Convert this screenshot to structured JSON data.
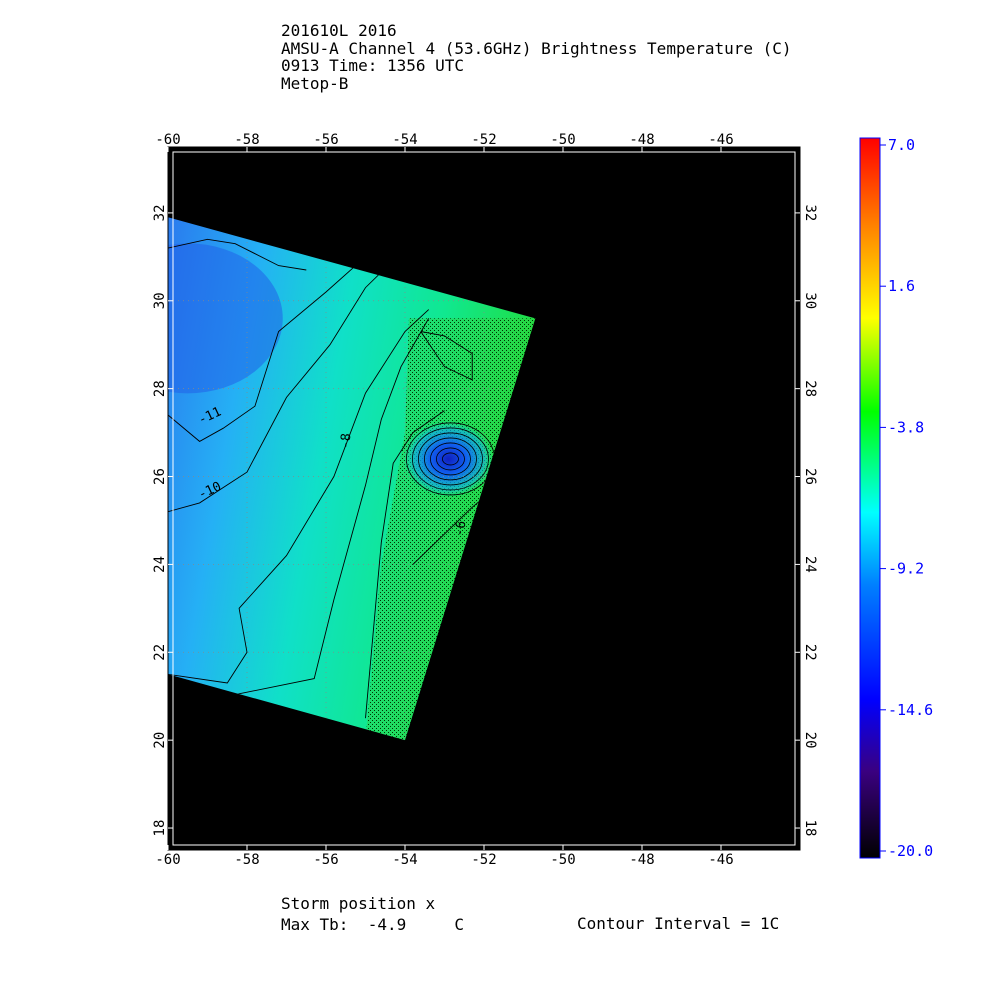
{
  "header": {
    "line1": "201610L 2016",
    "line2": "AMSU-A Channel 4 (53.6GHz) Brightness Temperature (C)",
    "line3": "0913 Time: 1356 UTC",
    "line4": "Metop-B"
  },
  "footer": {
    "storm_position": "Storm position x",
    "max_tb_label": "Max Tb:",
    "max_tb_value": "-4.9",
    "max_tb_unit": "C",
    "contour_interval": "Contour Interval = 1C"
  },
  "chart_data": {
    "type": "heatmap",
    "title": "AMSU-A Channel 4 (53.6GHz) Brightness Temperature (C)",
    "xlim": [
      -60,
      -44
    ],
    "ylim": [
      17.5,
      33.5
    ],
    "x_ticks": [
      "-60",
      "-58",
      "-56",
      "-54",
      "-52",
      "-50",
      "-48",
      "-46"
    ],
    "y_ticks": [
      "18",
      "20",
      "22",
      "24",
      "26",
      "28",
      "30",
      "32"
    ],
    "grid": true,
    "colorbar": {
      "min": -20.0,
      "max": 7.0,
      "tick_labels": [
        "7.0",
        "1.6",
        "-3.8",
        "-9.2",
        "-14.6",
        "-20.0"
      ],
      "tick_values": [
        7.0,
        1.6,
        -3.8,
        -9.2,
        -14.6,
        -20.0
      ],
      "colors": [
        "#000000",
        "#3a0080",
        "#0000ff",
        "#0080ff",
        "#00ffff",
        "#00ff00",
        "#ffff00",
        "#ff8000",
        "#ff0000"
      ]
    },
    "swath_corners_lonlat": [
      [
        -60,
        31.9
      ],
      [
        -50.7,
        29.6
      ],
      [
        -54.0,
        20.0
      ],
      [
        -60,
        21.5
      ]
    ],
    "contour_labels": [
      {
        "text": "-11",
        "lon": -58.9,
        "lat": 27.3,
        "angle": -25
      },
      {
        "text": "-10",
        "lon": -58.9,
        "lat": 25.6,
        "angle": -25
      },
      {
        "text": "-8",
        "lon": -55.4,
        "lat": 26.8,
        "angle": -85
      },
      {
        "text": "-6",
        "lon": -52.5,
        "lat": 24.8,
        "angle": -80
      }
    ],
    "cold_core": {
      "lon": -52.9,
      "lat": 26.4,
      "value": -13.5
    },
    "max_tb": -4.9,
    "contour_interval": 1,
    "storm_marker": "x"
  }
}
